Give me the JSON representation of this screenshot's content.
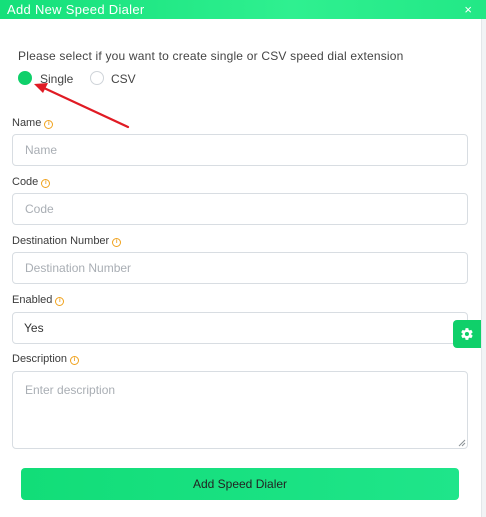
{
  "dialog": {
    "title": "Add New Speed Dialer",
    "close_glyph": "×"
  },
  "mode": {
    "prompt": "Please select if you want to create single or CSV speed dial extension",
    "options": [
      {
        "label": "Single",
        "selected": true
      },
      {
        "label": "CSV",
        "selected": false
      }
    ]
  },
  "fields": {
    "name": {
      "label": "Name",
      "placeholder": "Name",
      "value": ""
    },
    "code": {
      "label": "Code",
      "placeholder": "Code",
      "value": ""
    },
    "destination": {
      "label": "Destination Number",
      "placeholder": "Destination Number",
      "value": ""
    },
    "enabled": {
      "label": "Enabled",
      "value": "Yes"
    },
    "description": {
      "label": "Description",
      "placeholder": "Enter description",
      "value": ""
    }
  },
  "info_icon_glyph": "i",
  "actions": {
    "submit_label": "Add Speed Dialer"
  },
  "icons": {
    "info": "info-icon",
    "settings": "gear-icon",
    "annotation": "red-arrow-icon"
  },
  "colors": {
    "accent": "#0fd06a",
    "titlebar": "#22e886",
    "info": "#f0a21d",
    "annotation_arrow": "#e01b24"
  }
}
